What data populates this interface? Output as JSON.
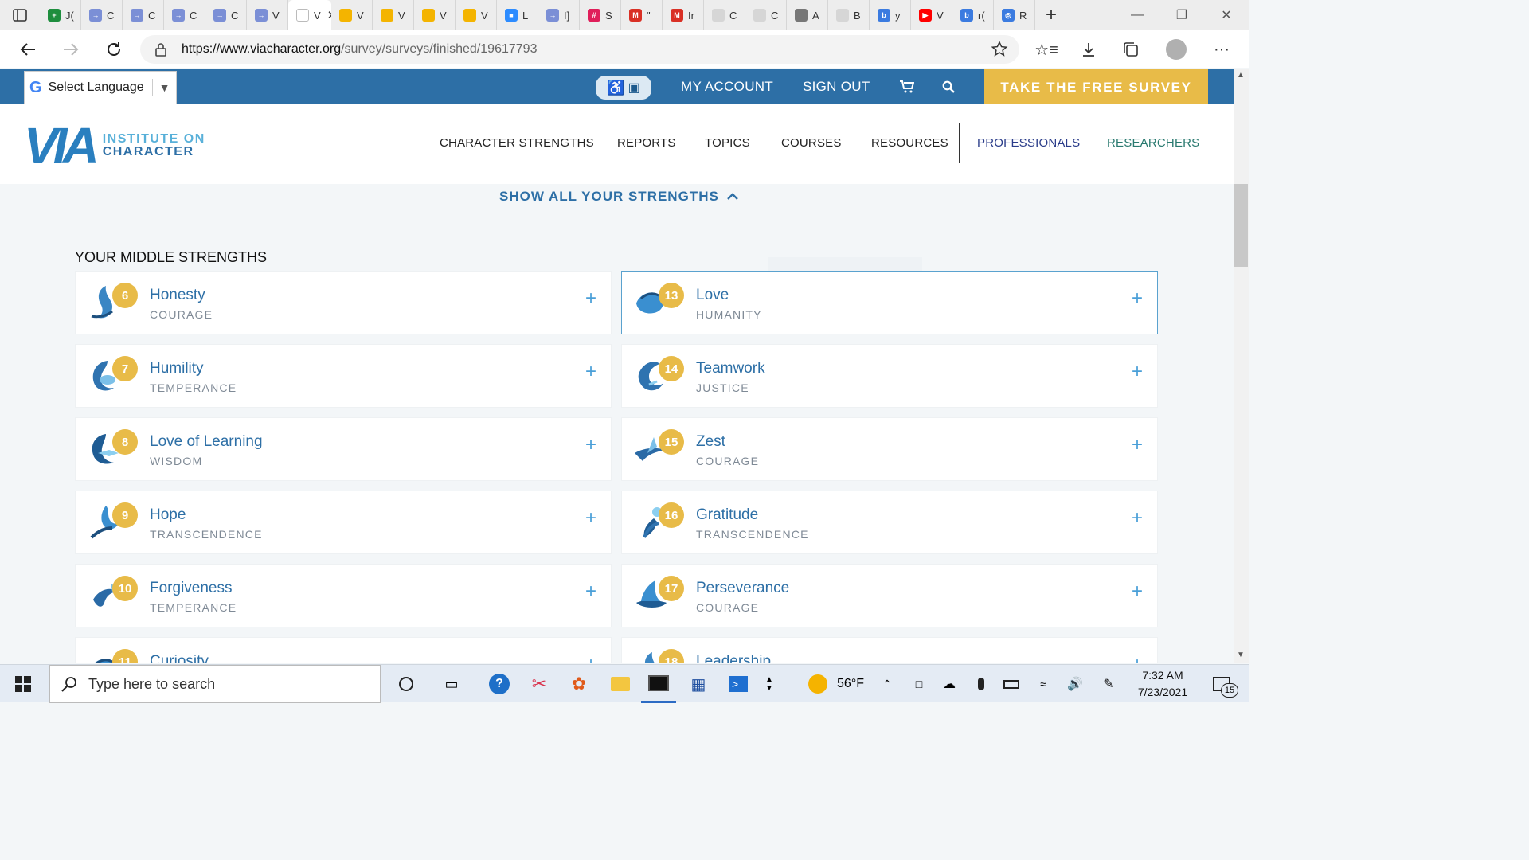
{
  "browser": {
    "tabs": [
      {
        "label": "J(",
        "color": "#1e8e3e",
        "glyph": "+"
      },
      {
        "label": "C",
        "color": "#7b8fd6",
        "glyph": "→"
      },
      {
        "label": "C",
        "color": "#7b8fd6",
        "glyph": "→"
      },
      {
        "label": "C",
        "color": "#7b8fd6",
        "glyph": "→"
      },
      {
        "label": "C",
        "color": "#7b8fd6",
        "glyph": "→"
      },
      {
        "label": "V",
        "color": "#7b8fd6",
        "glyph": "→"
      },
      {
        "label": "V",
        "color": "#ffffff",
        "glyph": "",
        "active": true
      },
      {
        "label": "V",
        "color": "#f4b400",
        "glyph": ""
      },
      {
        "label": "V",
        "color": "#f4b400",
        "glyph": ""
      },
      {
        "label": "V",
        "color": "#f4b400",
        "glyph": ""
      },
      {
        "label": "V",
        "color": "#f4b400",
        "glyph": ""
      },
      {
        "label": "L",
        "color": "#2d8cff",
        "glyph": "■"
      },
      {
        "label": "I]",
        "color": "#7b8fd6",
        "glyph": "→"
      },
      {
        "label": "S",
        "color": "#e01e5a",
        "glyph": "#"
      },
      {
        "label": "\"",
        "color": "#d93025",
        "glyph": "M"
      },
      {
        "label": "Ir",
        "color": "#d93025",
        "glyph": "M"
      },
      {
        "label": "C",
        "color": "#d6d6d6",
        "glyph": ""
      },
      {
        "label": "C",
        "color": "#d6d6d6",
        "glyph": ""
      },
      {
        "label": "A",
        "color": "#777777",
        "glyph": ""
      },
      {
        "label": "B",
        "color": "#d6d6d6",
        "glyph": ""
      },
      {
        "label": "y",
        "color": "#3b7be0",
        "glyph": "b"
      },
      {
        "label": "V",
        "color": "#ff0000",
        "glyph": "▶"
      },
      {
        "label": "r(",
        "color": "#3b7be0",
        "glyph": "b"
      },
      {
        "label": "R",
        "color": "#3b7be0",
        "glyph": "◎"
      }
    ],
    "url_host": "https://www.viacharacter.org",
    "url_path": "/survey/surveys/finished/19617793"
  },
  "site": {
    "language": "Select Language",
    "my_account": "MY ACCOUNT",
    "sign_out": "SIGN OUT",
    "cta": "TAKE THE FREE SURVEY",
    "logo_mark": "VIA",
    "logo_line1": "INSTITUTE ON",
    "logo_line2": "CHARACTER",
    "nav": [
      "CHARACTER STRENGTHS",
      "REPORTS",
      "TOPICS",
      "COURSES",
      "RESOURCES",
      "PROFESSIONALS",
      "RESEARCHERS"
    ],
    "show_all": "SHOW ALL YOUR STRENGTHS",
    "section_title": "YOUR MIDDLE STRENGTHS"
  },
  "strengths_left": [
    {
      "rank": "6",
      "name": "Honesty",
      "category": "COURAGE"
    },
    {
      "rank": "7",
      "name": "Humility",
      "category": "TEMPERANCE"
    },
    {
      "rank": "8",
      "name": "Love of Learning",
      "category": "WISDOM"
    },
    {
      "rank": "9",
      "name": "Hope",
      "category": "TRANSCENDENCE"
    },
    {
      "rank": "10",
      "name": "Forgiveness",
      "category": "TEMPERANCE"
    },
    {
      "rank": "11",
      "name": "Curiosity",
      "category": ""
    }
  ],
  "strengths_right": [
    {
      "rank": "13",
      "name": "Love",
      "category": "HUMANITY",
      "selected": true
    },
    {
      "rank": "14",
      "name": "Teamwork",
      "category": "JUSTICE"
    },
    {
      "rank": "15",
      "name": "Zest",
      "category": "COURAGE"
    },
    {
      "rank": "16",
      "name": "Gratitude",
      "category": "TRANSCENDENCE"
    },
    {
      "rank": "17",
      "name": "Perseverance",
      "category": "COURAGE"
    },
    {
      "rank": "18",
      "name": "Leadership",
      "category": ""
    }
  ],
  "taskbar": {
    "search_placeholder": "Type here to search",
    "weather": "56°F",
    "time": "7:32 AM",
    "date": "7/23/2021",
    "notifications": "15"
  }
}
